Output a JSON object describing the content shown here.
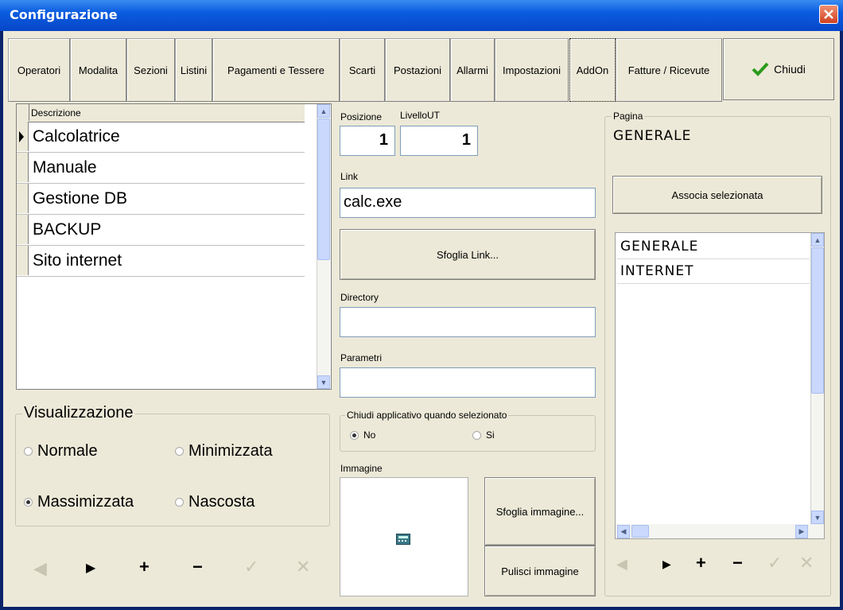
{
  "window": {
    "title": "Configurazione"
  },
  "tabs": [
    "Operatori",
    "Modalita",
    "Sezioni",
    "Listini",
    "Pagamenti e Tessere",
    "Scarti",
    "Postazioni",
    "Allarmi",
    "Impostazioni",
    "AddOn",
    "Fatture / Ricevute"
  ],
  "active_tab": "AddOn",
  "chiudi_label": "Chiudi",
  "grid": {
    "header": "Descrizione",
    "rows": [
      "Calcolatrice",
      "Manuale",
      "Gestione DB",
      "BACKUP",
      "Sito internet"
    ],
    "selected": "Calcolatrice"
  },
  "visualizzazione": {
    "title": "Visualizzazione",
    "options": [
      "Normale",
      "Minimizzata",
      "Massimizzata",
      "Nascosta"
    ],
    "selected": "Massimizzata"
  },
  "form": {
    "posizione_label": "Posizione",
    "posizione_value": "1",
    "livello_label": "LivelloUT",
    "livello_value": "1",
    "link_label": "Link",
    "link_value": "calc.exe",
    "sfoglia_link": "Sfoglia Link...",
    "directory_label": "Directory",
    "directory_value": "",
    "parametri_label": "Parametri",
    "parametri_value": "",
    "chiudi_group_label": "Chiudi applicativo quando selezionato",
    "chiudi_no": "No",
    "chiudi_si": "Si",
    "chiudi_selected": "No",
    "immagine_label": "Immagine",
    "sfoglia_immagine": "Sfoglia immagine...",
    "pulisci_immagine": "Pulisci immagine"
  },
  "pagina": {
    "title": "Pagina",
    "current": "GENERALE",
    "associa": "Associa selezionata",
    "items": [
      "GENERALE",
      "INTERNET"
    ]
  },
  "nav_icons": [
    "prev-icon",
    "next-icon",
    "add-icon",
    "remove-icon",
    "confirm-icon",
    "cancel-icon"
  ]
}
